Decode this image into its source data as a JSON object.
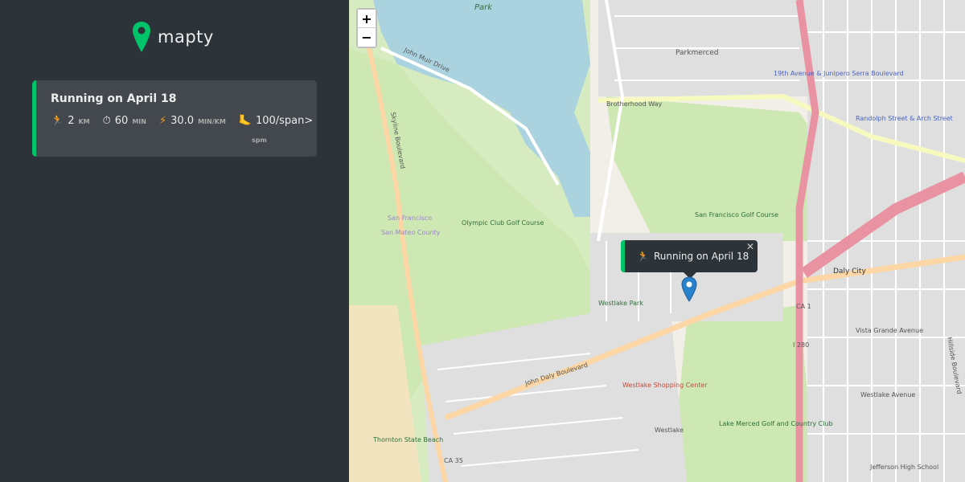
{
  "app": {
    "logo_text": "mapty",
    "brand_color": "#00c46a"
  },
  "workout": {
    "title": "Running on April 18",
    "distance": "2",
    "distance_unit": "km",
    "duration": "60",
    "duration_unit": "min",
    "pace": "30.0",
    "pace_unit": "min/km",
    "cadence": "100/span>",
    "cadence_unit": "spm",
    "icons": [
      "runner-icon",
      "stopwatch-icon",
      "lightning-icon",
      "footprint-icon"
    ]
  },
  "map": {
    "zoom_in": "+",
    "zoom_out": "−",
    "popup_text": "Running on April 18",
    "popup_close": "✕",
    "labels": {
      "park": "Park",
      "john_muir_drive": "John Muir Drive",
      "brotherhood_way": "Brotherhood Way",
      "skyline_boulevard": "Skyline Boulevard",
      "olympic_club": "Olympic Club Golf Course",
      "sf_golf": "San Francisco Golf Course",
      "sf_county": "San Francisco",
      "san_mateo": "San Mateo County",
      "john_daly": "John Daly Boulevard",
      "westlake_park": "Westlake Park",
      "westlake_shopping": "Westlake Shopping Center",
      "westlake": "Westlake",
      "lake_merced_golf": "Lake Merced Golf and Country Club",
      "thornton": "Thornton State Beach",
      "parkmerced": "Parkmerced",
      "nineteenth_junipero": "19th Avenue & Junipero Serra Boulevard",
      "randolph": "Randolph Street & Arch Street",
      "daly_city": "Daly City",
      "ca35": "CA 35",
      "ca1": "CA 1",
      "i280": "I 280",
      "jefferson": "Jefferson High School",
      "hillside": "Hillside Boulevard",
      "vista_grande": "Vista Grande Avenue",
      "westlake_ave": "Westlake Avenue"
    }
  }
}
